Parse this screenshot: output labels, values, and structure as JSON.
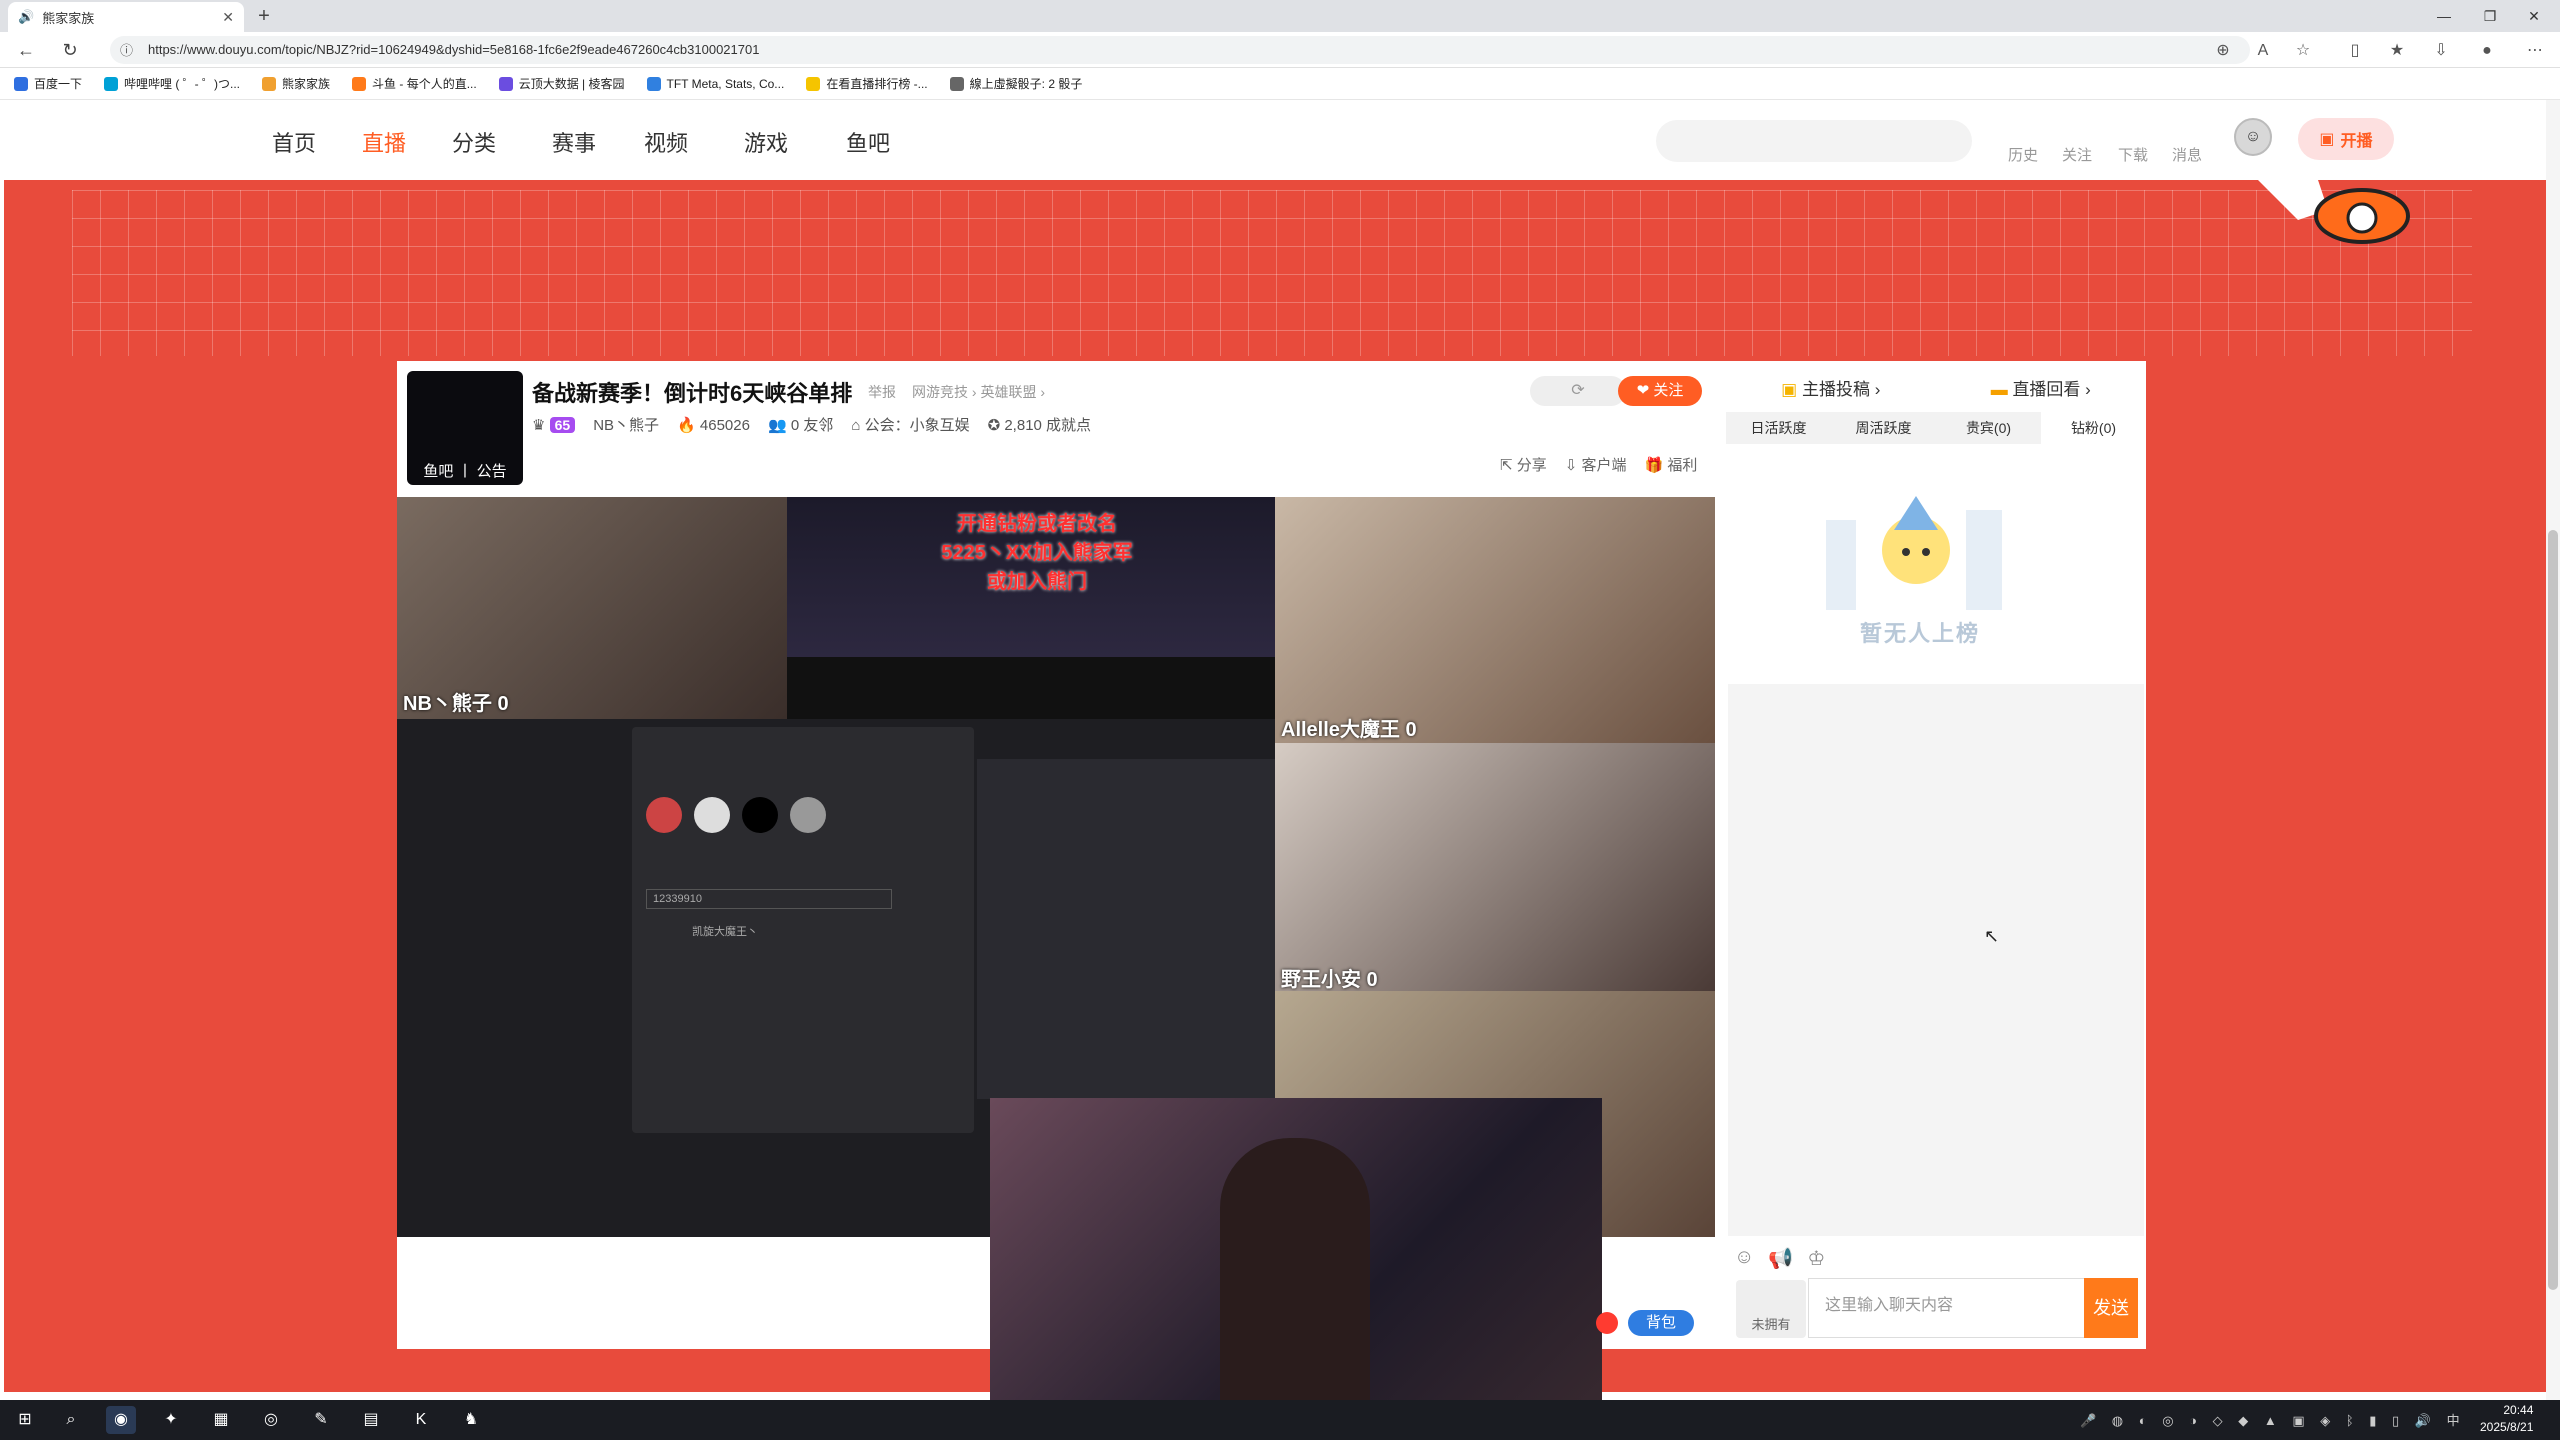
{
  "browser": {
    "tab_title": "熊家家族",
    "url": "https://www.douyu.com/topic/NBJZ?rid=10624949&dyshid=5e8168-1fc6e2f9eade467260c4cb3100021701",
    "bookmarks": [
      "百度一下",
      "哔哩哔哩 ( ゜- ゜)つ...",
      "熊家家族",
      "斗鱼 - 每个人的直...",
      "云顶大数据 | 棱客园",
      "TFT Meta, Stats, Co...",
      "在看直播排行榜 -...",
      "線上虛擬骰子: 2 骰子"
    ]
  },
  "site": {
    "nav": [
      "首页",
      "直播",
      "分类",
      "赛事",
      "视频",
      "游戏",
      "鱼吧"
    ],
    "active_nav": "直播",
    "header_links": [
      "历史",
      "关注",
      "下载",
      "消息"
    ],
    "kaibo": "开播"
  },
  "room": {
    "avatar_label": "鱼吧 丨 公告",
    "title": "备战新赛季！倒计时6天峡谷单排",
    "report": "举报",
    "crumbs": "网游竞技 › 英雄联盟 ›",
    "level": "65",
    "streamer": "NB丶熊子",
    "hot": "465026",
    "friends": "0 友邻",
    "guild": "公会：小象互娱",
    "points": "2,810 成就点",
    "follow": "关注",
    "share": "分享",
    "client": "客户端",
    "welfare": "福利",
    "backpack": "背包"
  },
  "video": {
    "tiles": [
      {
        "name": "NB丶熊子  0"
      },
      {
        "name": "Allelle大魔王  0"
      },
      {
        "name": "野王小安  0"
      }
    ],
    "overlay_text": "开通钻粉或者改名\n5225丶XX加入熊家军\n或加入熊门",
    "popup_input": "12339910",
    "popup_user": "凯旋大魔王丶"
  },
  "side": {
    "header": [
      "主播投稿 ›",
      "直播回看 ›"
    ],
    "rank_tabs": [
      "日活跃度",
      "周活跃度",
      "贵宾(0)",
      "钻粉(0)"
    ],
    "active_tab": "钻粉(0)",
    "empty": "暂无人上榜",
    "not_held": "未拥有",
    "chat_placeholder": "这里输入聊天内容",
    "send": "发送"
  },
  "taskbar": {
    "time": "20:44",
    "date": "2025/8/21",
    "ime": "中"
  },
  "colors": {
    "accent": "#ff5d23",
    "page_bg": "#e84b3c",
    "level_badge": "#a64cf0"
  }
}
